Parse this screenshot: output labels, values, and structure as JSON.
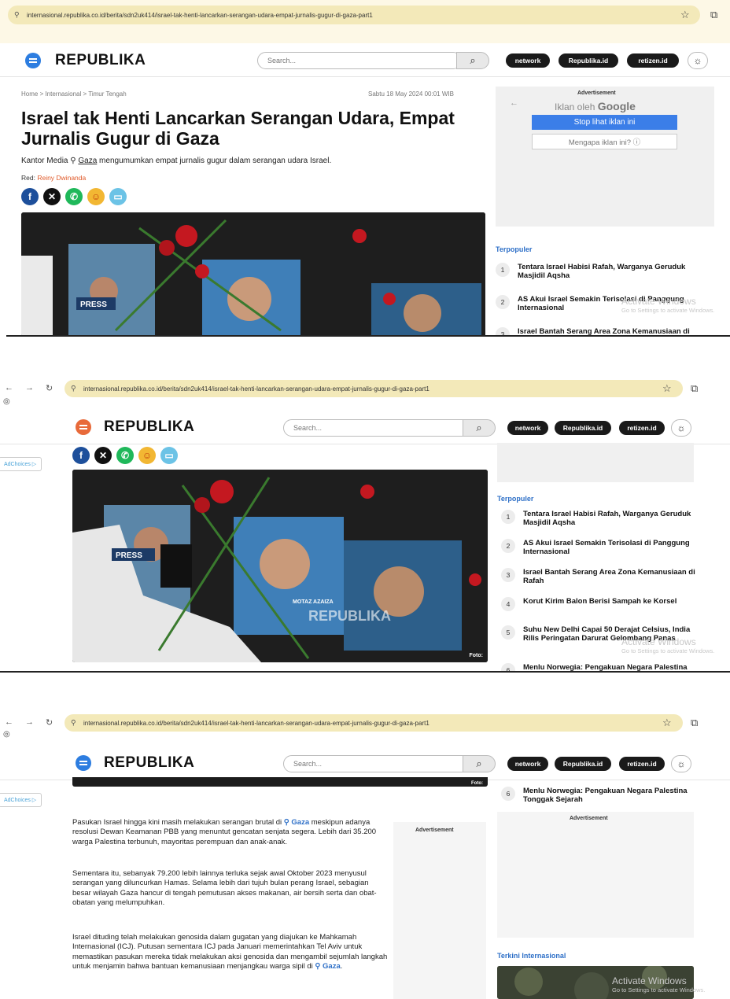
{
  "browser": {
    "url": "internasional.republika.co.id/berita/sdn2uk414/israel-tak-henti-lancarkan-serangan-udara-empat-jurnalis-gugur-di-gaza-part1"
  },
  "site": {
    "logo": "REPUBLIKA",
    "search_placeholder": "Search...",
    "pills": [
      "network",
      "Republika.id",
      "retizen.id"
    ]
  },
  "article": {
    "breadcrumb": "Home > Internasional > Timur Tengah",
    "date": "Sabtu 18 May 2024 00:01 WIB",
    "title": "Israel tak Henti Lancarkan Serangan Udara, Empat Jurnalis Gugur di Gaza",
    "lead_before": "Kantor Media ",
    "lead_link": "Gaza",
    "lead_after": " mengumumkan empat jurnalis gugur dalam serangan udara Israel.",
    "byline_label": "Red: ",
    "byline_name": "Reiny Dwinanda",
    "photo_credit": "Foto:",
    "photo_watermark": "REPUBLIKA",
    "photo_caption_name": "MOTAZ AZAIZA",
    "paragraphs": [
      {
        "before": "Pasukan Israel hingga kini masih melakukan serangan brutal di ",
        "link": "Gaza",
        "after": " meskipun adanya resolusi Dewan Keamanan PBB yang menuntut gencatan senjata segera. Lebih dari 35.200 warga Palestina terbunuh, mayoritas perempuan dan anak-anak."
      },
      {
        "before": "Sementara itu, sebanyak 79.200 lebih lainnya terluka sejak awal Oktober 2023 menyusul serangan yang diluncurkan Hamas. Selama lebih dari tujuh bulan perang Israel, sebagian besar wilayah Gaza hancur di tengah pemutusan akses makanan, air bersih serta dan obat-obatan yang melumpuhkan.",
        "link": "",
        "after": ""
      },
      {
        "before": "Israel dituding telah melakukan genosida dalam gugatan yang diajukan ke Mahkamah Internasional (ICJ). Putusan sementara ICJ pada Januari memerintahkan Tel Aviv untuk memastikan pasukan mereka tidak melakukan aksi genosida dan mengambil sejumlah langkah untuk menjamin bahwa bantuan kemanusiaan menjangkau warga sipil di ",
        "link": "Gaza",
        "after": "."
      }
    ]
  },
  "ads": {
    "advertisement": "Advertisement",
    "google_prefix": "Iklan oleh",
    "google_brand": "Google",
    "stop": "Stop lihat iklan ini",
    "why": "Mengapa iklan ini? ⓘ",
    "adchoices": "AdChoices ▷"
  },
  "sidebar": {
    "popular_heading": "Terpopuler",
    "popular": [
      {
        "num": "1",
        "title": "Tentara Israel Habisi Rafah, Warganya Geruduk Masjidil Aqsha"
      },
      {
        "num": "2",
        "title": "AS Akui Israel Semakin Terisolasi di Panggung Internasional"
      },
      {
        "num": "3",
        "title": "Israel Bantah Serang Area Zona Kemanusiaan di Rafah"
      },
      {
        "num": "4",
        "title": "Korut Kirim Balon Berisi Sampah ke Korsel"
      },
      {
        "num": "5",
        "title": "Suhu New Delhi Capai 50 Derajat Celsius, India Rilis Peringatan Darurat Gelombang Panas"
      },
      {
        "num": "6",
        "title": "Menlu Norwegia: Pengakuan Negara Palestina Tonggak Sejarah"
      }
    ],
    "terkini_heading": "Terkini Internasional"
  },
  "windows_watermark": {
    "line1": "Activate Windows",
    "line2": "Go to Settings to activate Windows."
  },
  "colors": {
    "accent_orange": "#e86a3a",
    "link_blue": "#2d6fc7",
    "chrome_bar": "#fdf8e6",
    "google_button": "#3b7ee8"
  }
}
